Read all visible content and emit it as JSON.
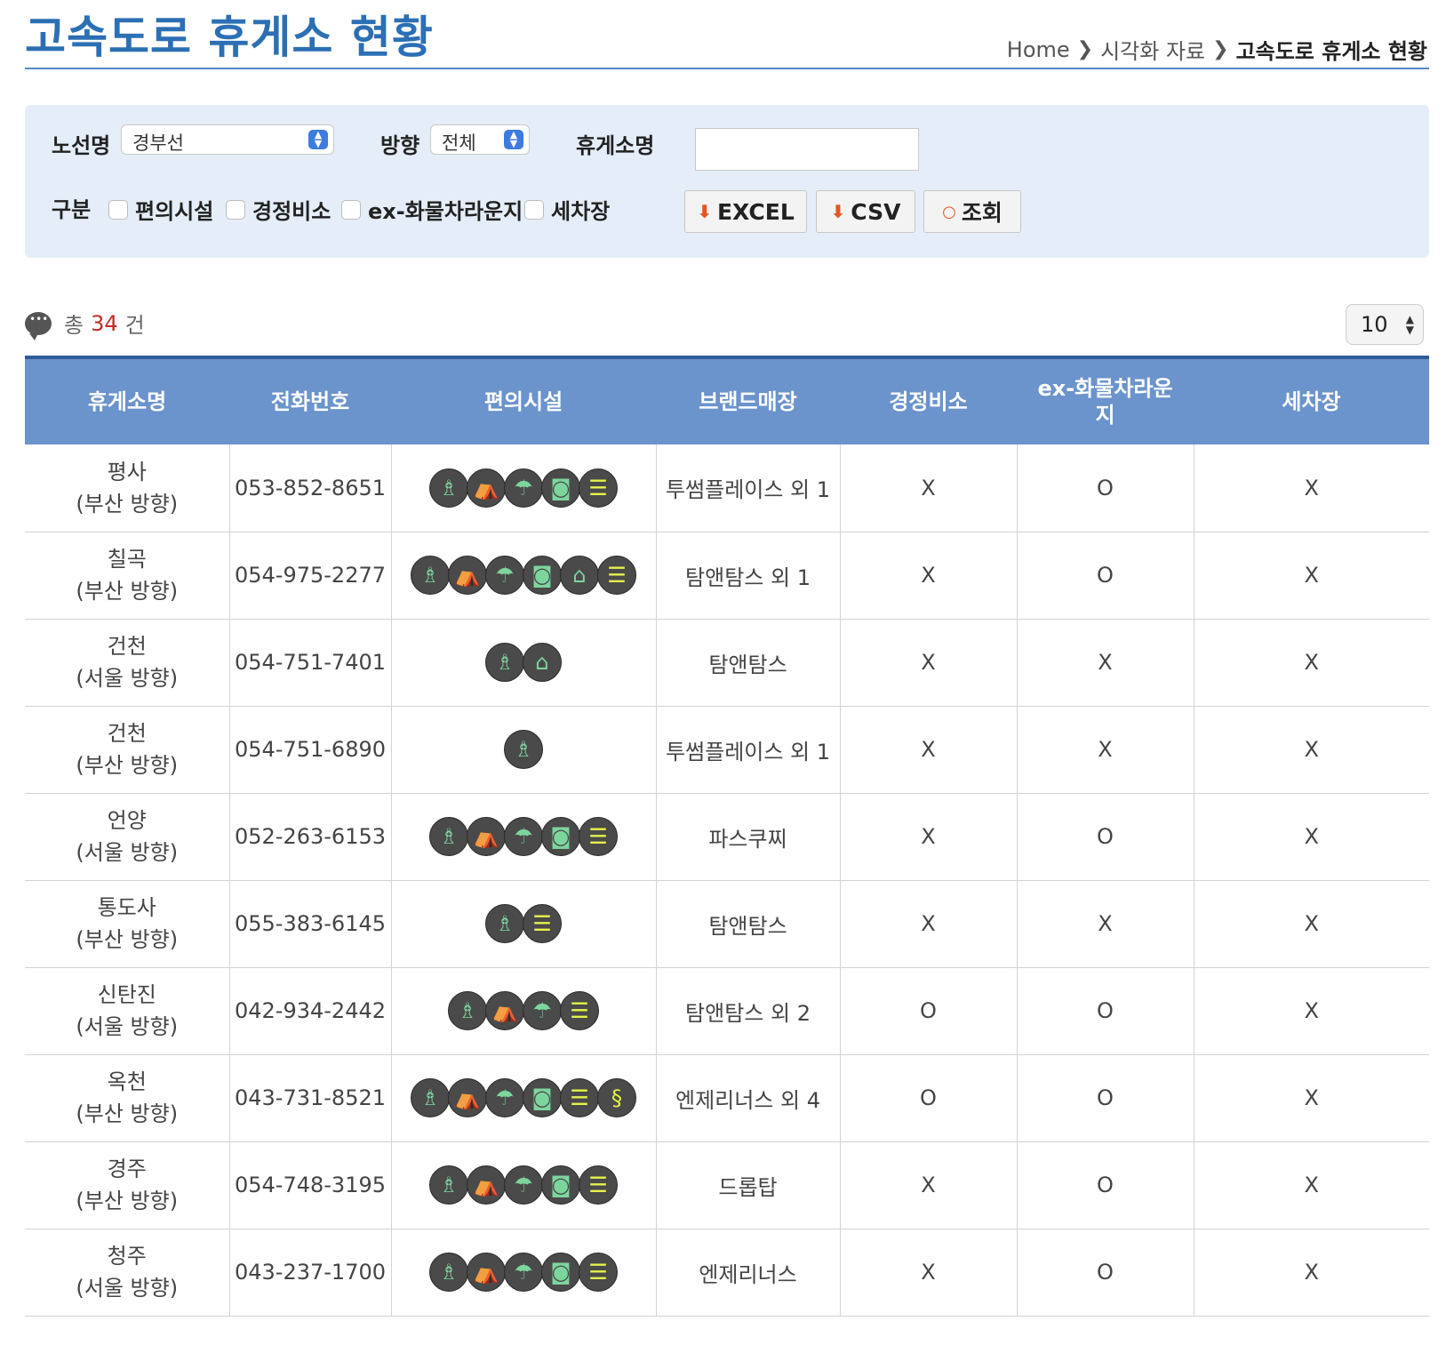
{
  "header": {
    "title": "고속도로 휴게소 현황",
    "breadcrumb": {
      "home": "Home",
      "level2": "시각화 자료",
      "current": "고속도로 휴게소 현황"
    }
  },
  "search": {
    "route_label": "노선명",
    "route_value": "경부선",
    "direction_label": "방향",
    "direction_value": "전체",
    "restarea_label": "휴게소명",
    "restarea_value": "",
    "category_label": "구분",
    "checkboxes": [
      "편의시설",
      "경정비소",
      "ex-화물차라운지",
      "세차장"
    ],
    "excel_label": "EXCEL",
    "csv_label": "CSV",
    "query_label": "조회"
  },
  "summary": {
    "prefix": "총",
    "count": "34",
    "suffix": "건",
    "per_page": "10"
  },
  "table": {
    "headers": [
      "휴게소명",
      "전화번호",
      "편의시설",
      "브랜드매장",
      "경정비소",
      "ex-화물차라운지",
      "세차장"
    ],
    "rows": [
      {
        "name": "평사",
        "direction": "(부산 방향)",
        "phone": "053-852-8651",
        "facilities": [
          "nursing-room-icon",
          "sleeping-room-icon",
          "shower-icon",
          "laundry-icon",
          "bench-icon"
        ],
        "brand": "투썸플레이스 외 1",
        "repair": "X",
        "truck_lounge": "O",
        "carwash": "X"
      },
      {
        "name": "칠곡",
        "direction": "(부산 방향)",
        "phone": "054-975-2277",
        "facilities": [
          "nursing-room-icon",
          "sleeping-room-icon",
          "shower-icon",
          "laundry-icon",
          "shopping-basket-icon",
          "bench-icon"
        ],
        "brand": "탐앤탐스 외 1",
        "repair": "X",
        "truck_lounge": "O",
        "carwash": "X"
      },
      {
        "name": "건천",
        "direction": "(서울 방향)",
        "phone": "054-751-7401",
        "facilities": [
          "nursing-room-icon",
          "shopping-basket-icon"
        ],
        "brand": "탐앤탐스",
        "repair": "X",
        "truck_lounge": "X",
        "carwash": "X"
      },
      {
        "name": "건천",
        "direction": "(부산 방향)",
        "phone": "054-751-6890",
        "facilities": [
          "nursing-room-icon"
        ],
        "brand": "투썸플레이스 외 1",
        "repair": "X",
        "truck_lounge": "X",
        "carwash": "X"
      },
      {
        "name": "언양",
        "direction": "(서울 방향)",
        "phone": "052-263-6153",
        "facilities": [
          "nursing-room-icon",
          "sleeping-room-icon",
          "shower-icon",
          "laundry-icon",
          "bench-icon"
        ],
        "brand": "파스쿠찌",
        "repair": "X",
        "truck_lounge": "O",
        "carwash": "X"
      },
      {
        "name": "통도사",
        "direction": "(부산 방향)",
        "phone": "055-383-6145",
        "facilities": [
          "nursing-room-icon",
          "bench-icon"
        ],
        "brand": "탐앤탐스",
        "repair": "X",
        "truck_lounge": "X",
        "carwash": "X"
      },
      {
        "name": "신탄진",
        "direction": "(서울 방향)",
        "phone": "042-934-2442",
        "facilities": [
          "nursing-room-icon",
          "sleeping-room-icon",
          "shower-icon",
          "bench-icon"
        ],
        "brand": "탐앤탐스 외 2",
        "repair": "O",
        "truck_lounge": "O",
        "carwash": "X"
      },
      {
        "name": "옥천",
        "direction": "(부산 방향)",
        "phone": "043-731-8521",
        "facilities": [
          "nursing-room-icon",
          "sleeping-room-icon",
          "shower-icon",
          "laundry-icon",
          "bench-icon",
          "barber-pole-icon"
        ],
        "brand": "엔제리너스 외 4",
        "repair": "O",
        "truck_lounge": "O",
        "carwash": "X"
      },
      {
        "name": "경주",
        "direction": "(부산 방향)",
        "phone": "054-748-3195",
        "facilities": [
          "nursing-room-icon",
          "sleeping-room-icon",
          "shower-icon",
          "laundry-icon",
          "bench-icon"
        ],
        "brand": "드롭탑",
        "repair": "X",
        "truck_lounge": "O",
        "carwash": "X"
      },
      {
        "name": "청주",
        "direction": "(서울 방향)",
        "phone": "043-237-1700",
        "facilities": [
          "nursing-room-icon",
          "sleeping-room-icon",
          "shower-icon",
          "laundry-icon",
          "bench-icon"
        ],
        "brand": "엔제리너스",
        "repair": "X",
        "truck_lounge": "O",
        "carwash": "X"
      }
    ]
  }
}
